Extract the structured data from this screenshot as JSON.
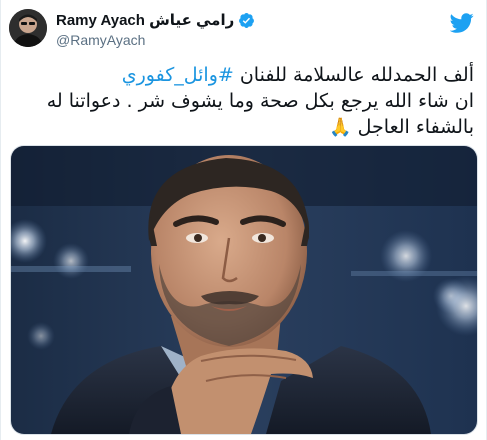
{
  "author": {
    "display_name": "Ramy Ayach رامي عياش",
    "handle": "@RamyAyach",
    "verified": true
  },
  "tweet": {
    "line1_prefix": "ألف الحمدلله عالسلامة للفنان ",
    "line1_hashtag": "#وائل_كفوري",
    "line2": "ان شاء الله يرجع بكل صحة وما يشوف شر . دعواتنا له",
    "line3": "بالشفاء العاجل ",
    "emoji": "🙏"
  },
  "icons": {
    "avatar": "user-avatar",
    "verified": "verified-badge-icon",
    "logo": "twitter-bird-icon"
  },
  "colors": {
    "hashtag": "#1b95e0",
    "verified": "#1da1f2",
    "handle": "#5b7083"
  }
}
